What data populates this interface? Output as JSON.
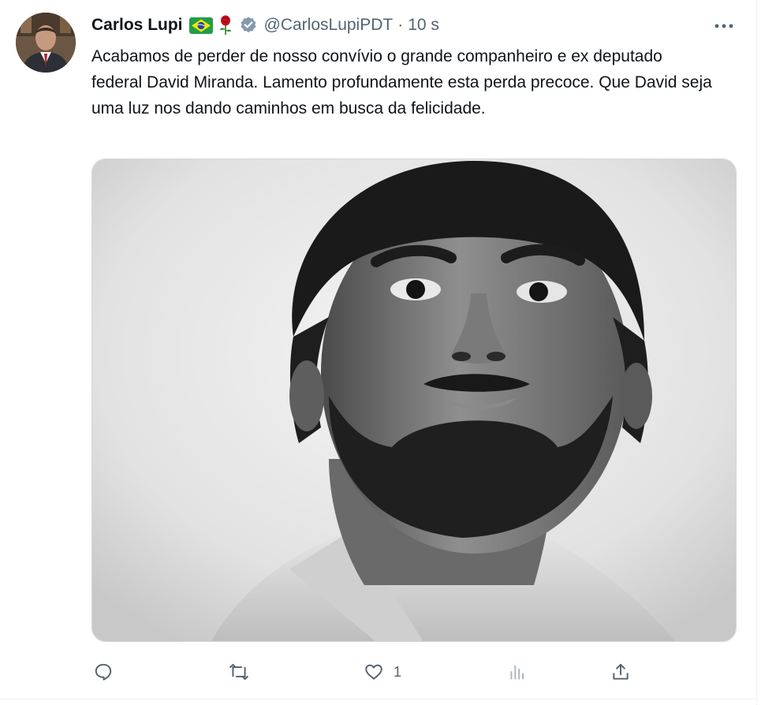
{
  "author": {
    "display_name": "Carlos Lupi",
    "handle": "@CarlosLupiPDT",
    "separator": "·",
    "timestamp": "10 s"
  },
  "tweet": {
    "text": "Acabamos de perder de nosso convívio o grande companheiro e ex deputado federal David Miranda. Lamento profundamente esta perda precoce. Que David seja uma luz nos dando caminhos em busca da felicidade."
  },
  "actions": {
    "reply_count": "",
    "retweet_count": "",
    "like_count": "1",
    "views_count": ""
  },
  "icons": {
    "more": "more-options-icon",
    "verified": "verified-badge-icon",
    "reply": "reply-icon",
    "retweet": "retweet-icon",
    "like": "heart-icon",
    "views": "views-chart-icon",
    "share": "share-icon"
  },
  "colors": {
    "text_primary": "#0f1419",
    "text_secondary": "#536471",
    "verified_badge": "#829aab",
    "border": "#cfd9de"
  }
}
